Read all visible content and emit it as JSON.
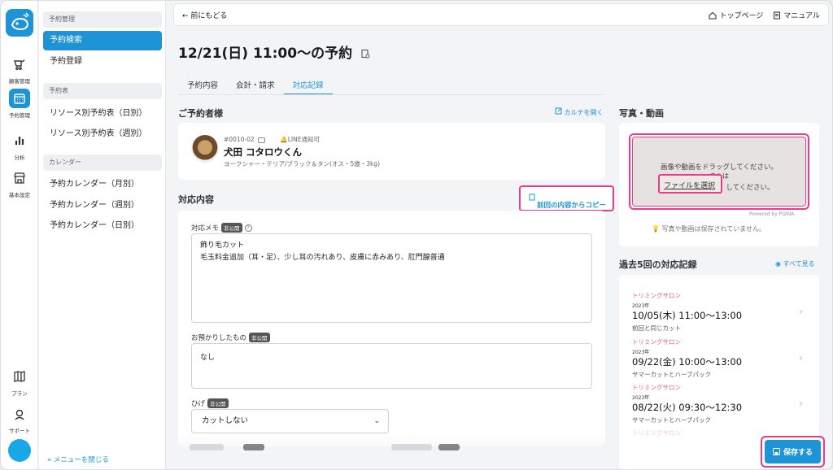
{
  "rail": {
    "items": [
      {
        "label": "顧客管理",
        "icon": "customer-icon"
      },
      {
        "label": "予約管理",
        "icon": "calendar-icon"
      },
      {
        "label": "分析",
        "icon": "chart-icon"
      },
      {
        "label": "基本設定",
        "icon": "store-icon"
      },
      {
        "label": "プラン",
        "icon": "map-icon"
      },
      {
        "label": "サポート",
        "icon": "support-icon"
      }
    ]
  },
  "submenu": {
    "sections": [
      {
        "title": "予約管理",
        "items": [
          "予約検索",
          "予約登録"
        ]
      },
      {
        "title": "予約表",
        "items": [
          "リソース別予約表（日別）",
          "リソース別予約表（週別）"
        ]
      },
      {
        "title": "カレンダー",
        "items": [
          "予約カレンダー（月別）",
          "予約カレンダー（週別）",
          "予約カレンダー（日別）"
        ]
      }
    ],
    "close_label": "«  メニューを閉じる"
  },
  "topbar": {
    "back": "←  前にもどる",
    "top_page": "トップページ",
    "manual": "マニュアル"
  },
  "page": {
    "title": "12/21(日) 11:00〜の予約"
  },
  "tabs": [
    "予約内容",
    "会計・請求",
    "対応記録"
  ],
  "customer": {
    "section_title": "ご予約者様",
    "open_chart": "カルテを開く",
    "pet_id": "#0010-02",
    "line": "LINE通知可",
    "name": "犬田 コタロウくん",
    "desc": "ヨークシャー・テリア/ブラック＆タン(オス・5歳・3kg)"
  },
  "response": {
    "section_title": "対応内容",
    "copy_button": "前回の内容からコピー",
    "memo_label": "対応メモ",
    "private_badge": "非公開",
    "memo_line1": "飾り毛カット",
    "memo_line2": "毛玉料金追加（耳・足）、少し耳の汚れあり、皮膚に赤みあり、肛門腺普通",
    "deposit_label": "お預かりしたもの",
    "deposit_value": "なし",
    "beard_label": "ひげ",
    "beard_value": "カットしない"
  },
  "media": {
    "section_title": "写真・動画",
    "drop_text": "画像や動画をドラッグしてください。",
    "or_text": "または",
    "after_button": "してください。",
    "file_button": "ファイルを選択",
    "powered": "Powered by PQINA",
    "not_saved": "写真や動画は保存されていません。"
  },
  "history": {
    "section_title": "過去5回の対応記録",
    "see_all": "すべて見る",
    "items": [
      {
        "category": "トリミングサロン",
        "year": "2023年",
        "date": "10/05(木) 11:00〜13:00",
        "note": "前回と同じカット"
      },
      {
        "category": "トリミングサロン",
        "year": "2023年",
        "date": "09/22(金) 10:00〜13:00",
        "note": "サマーカットとハーブパック"
      },
      {
        "category": "トリミングサロン",
        "year": "2023年",
        "date": "08/22(火) 09:30〜12:30",
        "note": "サマーカットとハーブパック"
      },
      {
        "category": "トリミングサロン",
        "year": "",
        "date": "",
        "note": ""
      }
    ]
  },
  "save_button": "保存する",
  "colors": {
    "accent": "#1e94d6",
    "highlight": "#ea3c8d",
    "category": "#e0607e"
  }
}
